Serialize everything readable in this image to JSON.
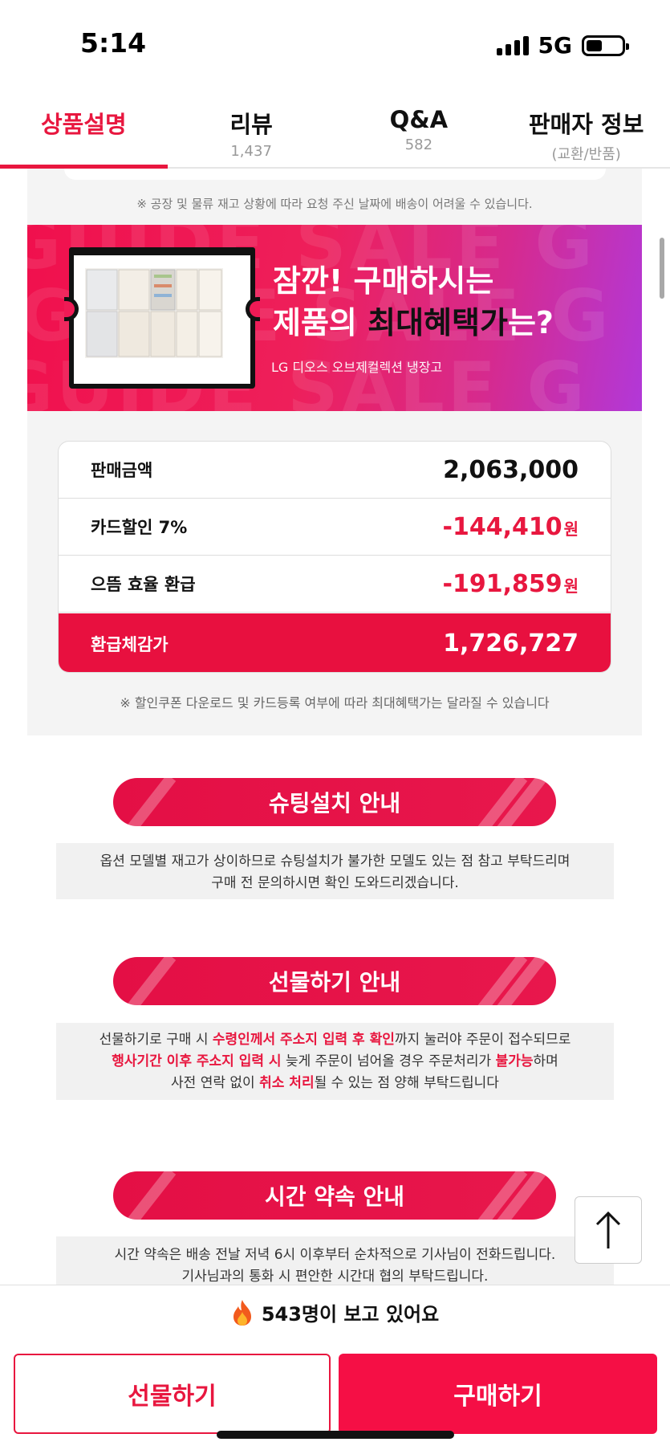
{
  "status": {
    "time": "5:14",
    "network": "5G",
    "battery_level": 0.45
  },
  "tabs": [
    {
      "label": "상품설명",
      "sub": ""
    },
    {
      "label": "리뷰",
      "sub": "1,437"
    },
    {
      "label": "Q&A",
      "sub": "582"
    },
    {
      "label": "판매자 정보",
      "sub": "(교환/반품)"
    }
  ],
  "active_tab": 0,
  "notice_top": "※ 공장 및 물류 재고 상황에 따라 요청 주신 날짜에 배송이 어려울 수 있습니다.",
  "banner": {
    "bg_text": "GUIDE SALE G",
    "title_line1": "잠깐! 구매하시는",
    "title_line2_a": "제품의 ",
    "title_line2_b": "최대혜택가",
    "title_line2_c": "는?",
    "subtitle": "LG 디오스 오브제컬렉션 냉장고"
  },
  "price_table": {
    "rows": [
      {
        "label": "판매금액",
        "value": "2,063,000",
        "unit": ""
      },
      {
        "label": "카드할인 7%",
        "value": "-144,410",
        "unit": "원"
      },
      {
        "label": "으뜸 효율 환급",
        "value": "-191,859",
        "unit": "원"
      }
    ],
    "total": {
      "label": "환급체감가",
      "value": "1,726,727"
    }
  },
  "notice_bottom": "※ 할인쿠폰 다운로드 및 카드등록 여부에 따라 최대혜택가는 달라질 수 있습니다",
  "sections": {
    "chuting": {
      "title": "슈팅설치 안내",
      "line1": "옵션 모델별 재고가 상이하므로 슈팅설치가 불가한 모델도 있는 점 참고 부탁드리며",
      "line2": "구매 전 문의하시면 확인 도와드리겠습니다."
    },
    "gift": {
      "title": "선물하기 안내",
      "l1a": "선물하기로 구매 시 ",
      "l1b": "수령인께서 주소지 입력 후 확인",
      "l1c": "까지 눌러야 주문이 접수되므로",
      "l2a": "행사기간 이후 주소지 입력 시",
      "l2b": " 늦게 주문이 넘어올 경우 주문처리가 ",
      "l2c": "불가능",
      "l2d": "하며",
      "l3a": "사전 연락 없이 ",
      "l3b": "취소 처리",
      "l3c": "될 수 있는 점 양해 부탁드립니다"
    },
    "time": {
      "title": "시간 약속 안내",
      "line1": "시간 약속은 배송 전날 저녁 6시 이후부터 순차적으로 기사님이 전화드립니다.",
      "line2": "기사님과의 통화 시 편안한 시간대 협의 부탁드립니다."
    }
  },
  "viewers": "543명이 보고 있어요",
  "buttons": {
    "gift": "선물하기",
    "buy": "구매하기"
  },
  "colors": {
    "accent": "#e8173f",
    "buy_button": "#f50f45"
  }
}
